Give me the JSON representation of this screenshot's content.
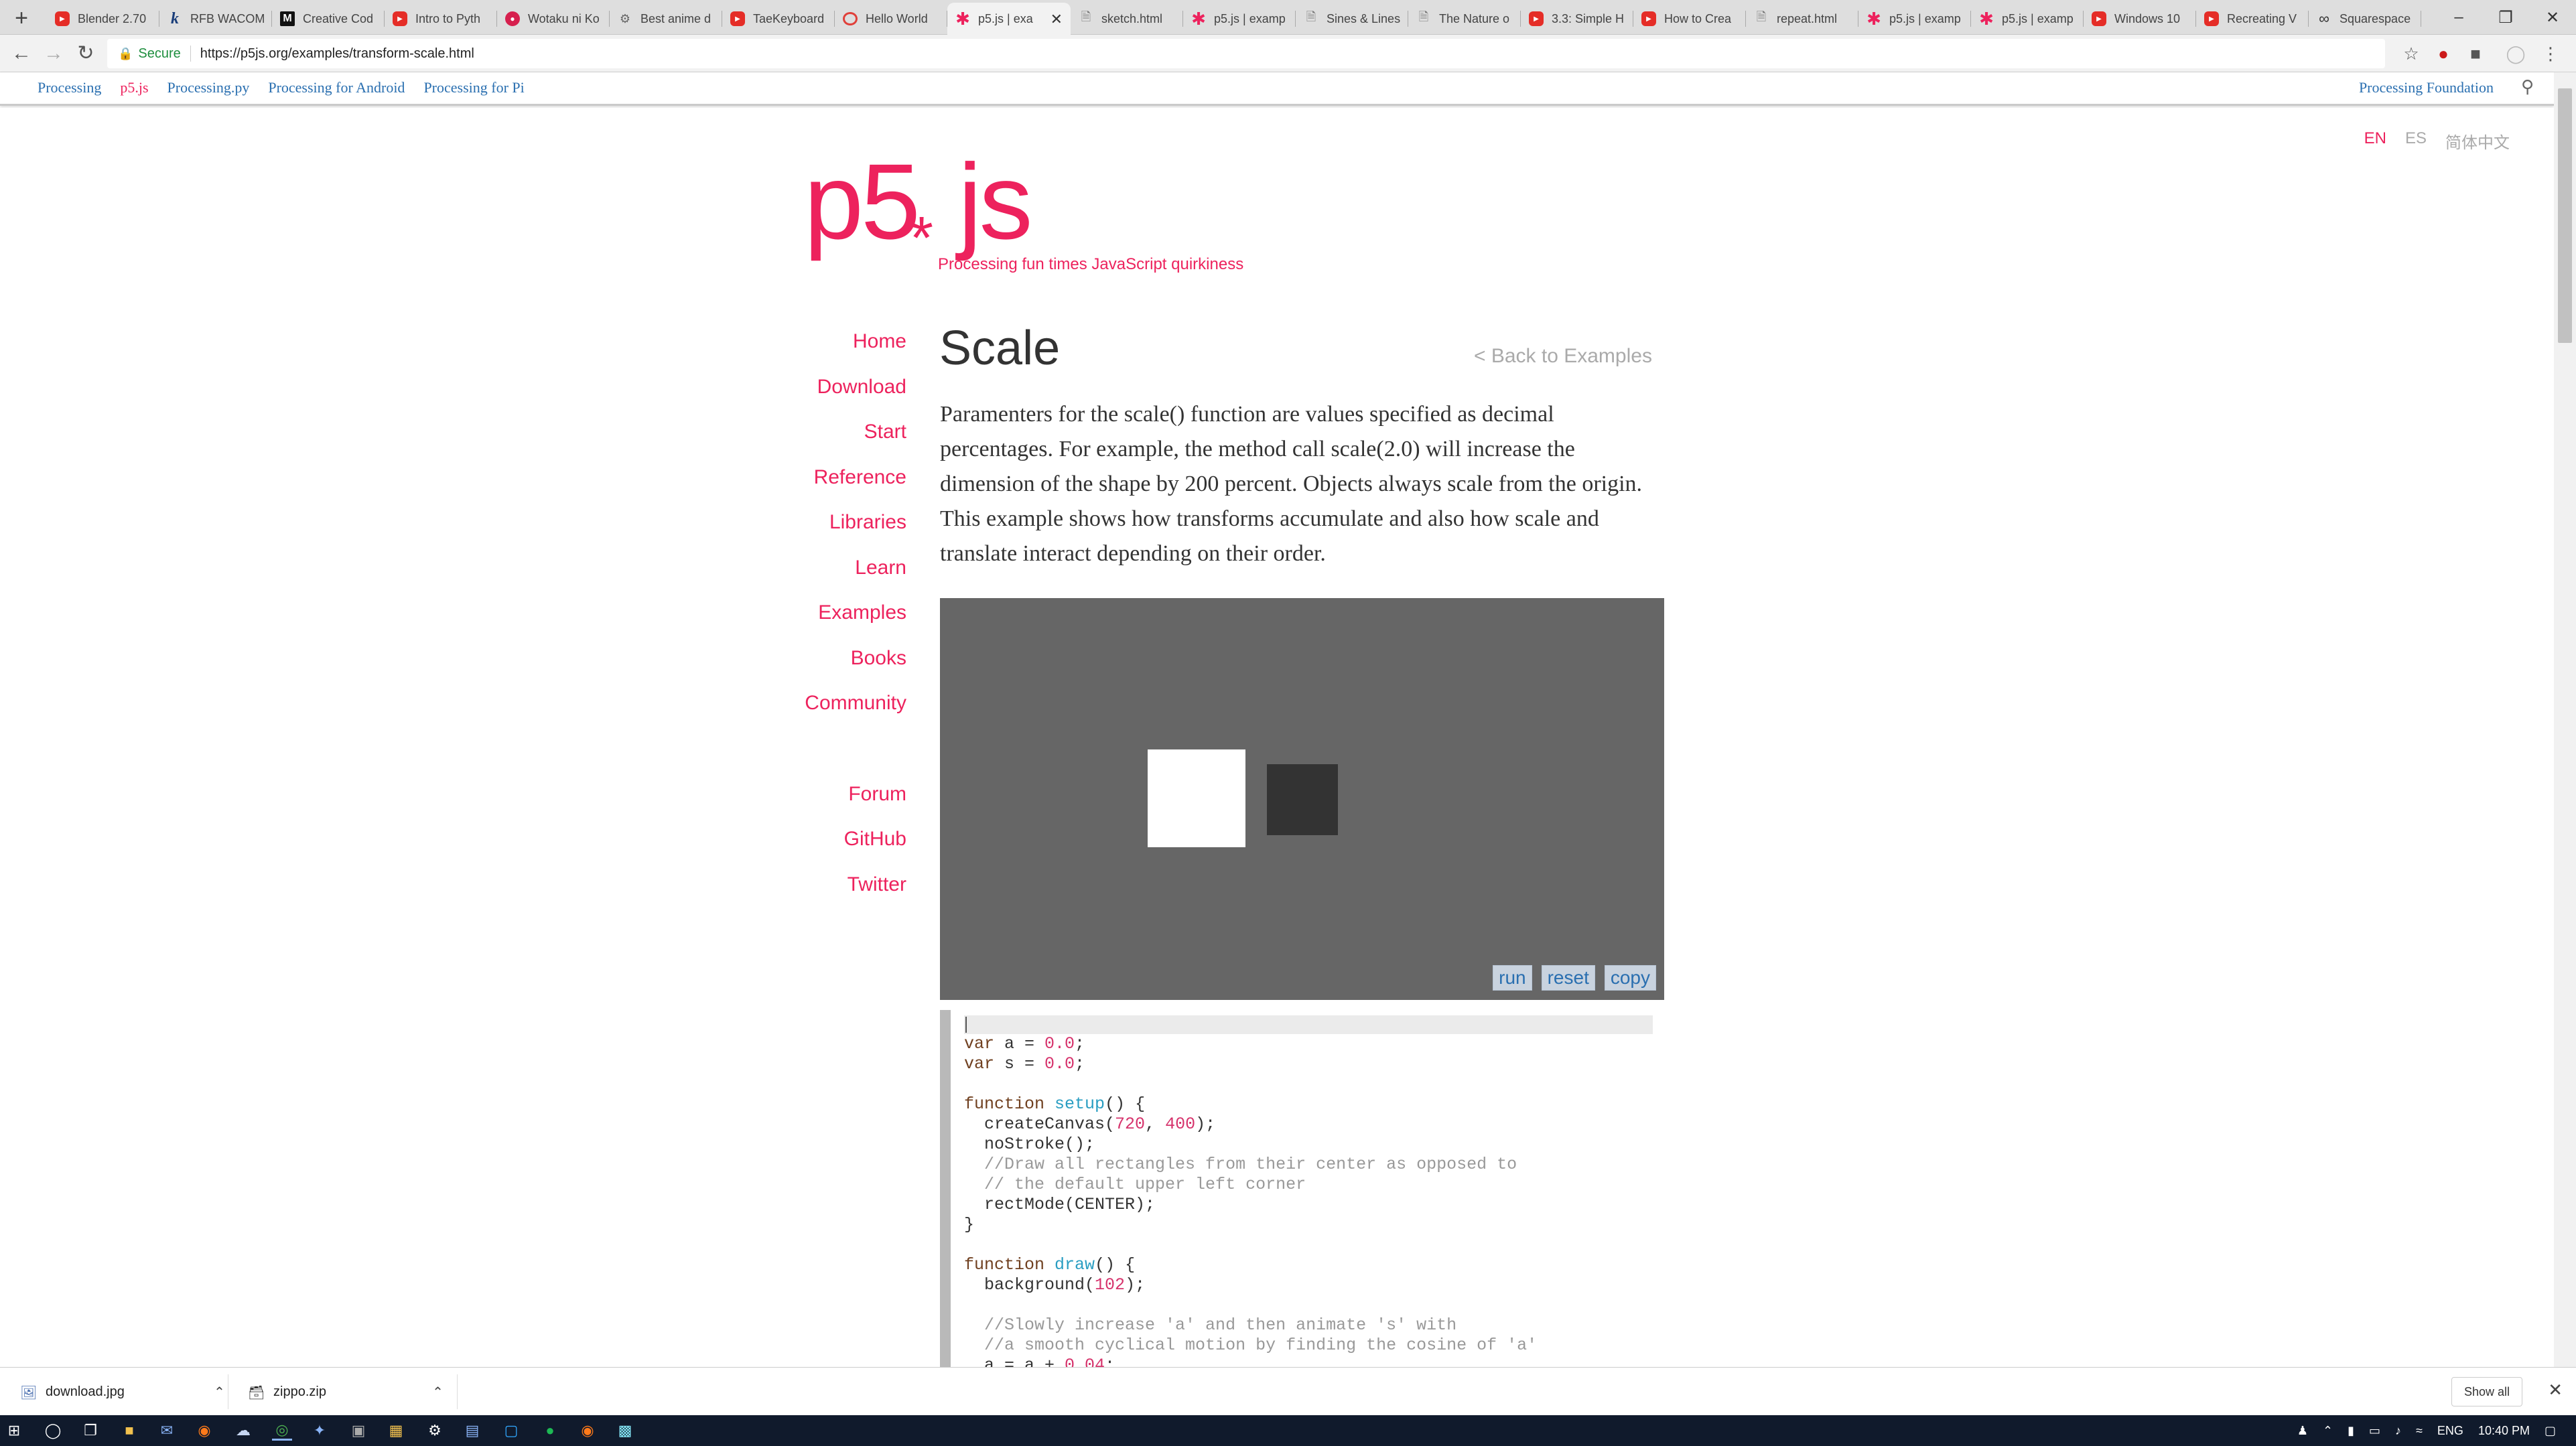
{
  "browser": {
    "tabs": [
      {
        "label": "Blender 2.70",
        "icon": "youtube-icon"
      },
      {
        "label": "RFB WACOM",
        "icon": "k-icon"
      },
      {
        "label": "Creative Cod",
        "icon": "medium-icon"
      },
      {
        "label": "Intro to Pyth",
        "icon": "youtube-icon"
      },
      {
        "label": "Wotaku ni Ko",
        "icon": "wo-icon"
      },
      {
        "label": "Best anime d",
        "icon": "download-icon"
      },
      {
        "label": "TaeKeyboard",
        "icon": "youtube-icon"
      },
      {
        "label": "Hello World",
        "icon": "hello-icon"
      },
      {
        "label": "p5.js | exa",
        "icon": "p5-icon",
        "active": true
      },
      {
        "label": "sketch.html",
        "icon": "document-icon"
      },
      {
        "label": "p5.js | examp",
        "icon": "p5-icon"
      },
      {
        "label": "Sines & Lines",
        "icon": "document-icon"
      },
      {
        "label": "The Nature o",
        "icon": "document-icon"
      },
      {
        "label": "3.3: Simple H",
        "icon": "youtube-icon"
      },
      {
        "label": "How to Crea",
        "icon": "youtube-icon"
      },
      {
        "label": "repeat.html",
        "icon": "document-icon"
      },
      {
        "label": "p5.js | examp",
        "icon": "p5-icon"
      },
      {
        "label": "p5.js | examp",
        "icon": "p5-icon"
      },
      {
        "label": "Windows 10",
        "icon": "youtube-icon"
      },
      {
        "label": "Recreating V",
        "icon": "youtube-icon"
      },
      {
        "label": "Squarespace",
        "icon": "squarespace-icon"
      }
    ],
    "secure_label": "Secure",
    "url": "https://p5js.org/examples/transform-scale.html"
  },
  "processing_bar": {
    "links": [
      "Processing",
      "p5.js",
      "Processing.py",
      "Processing for Android",
      "Processing for Pi"
    ],
    "current": "p5.js",
    "foundation": "Processing Foundation"
  },
  "languages": [
    "EN",
    "ES",
    "简体中文"
  ],
  "site": {
    "logo_p5": "p5",
    "logo_star": "*",
    "logo_js": "js",
    "tagline": "Processing fun times JavaScript quirkiness"
  },
  "nav": {
    "main": [
      "Home",
      "Download",
      "Start",
      "Reference",
      "Libraries",
      "Learn",
      "Examples",
      "Books",
      "Community"
    ],
    "social": [
      "Forum",
      "GitHub",
      "Twitter"
    ]
  },
  "example": {
    "title": "Scale",
    "back_link": "< Back to Examples",
    "description": "Paramenters for the scale() function are values specified as decimal percentages. For example, the method call scale(2.0) will increase the dimension of the shape by 200 percent. Objects always scale from the origin. This example shows how transforms accumulate and also how scale and translate interact depending on their order.",
    "buttons": {
      "run": "run",
      "reset": "reset",
      "copy": "copy"
    },
    "code": [
      [
        [
          "kw",
          "var"
        ],
        [
          "t",
          " a = "
        ],
        [
          "num",
          "0.0"
        ],
        [
          "t",
          ";"
        ]
      ],
      [
        [
          "kw",
          "var"
        ],
        [
          "t",
          " s = "
        ],
        [
          "num",
          "0.0"
        ],
        [
          "t",
          ";"
        ]
      ],
      [],
      [
        [
          "kw",
          "function"
        ],
        [
          "t",
          " "
        ],
        [
          "fn",
          "setup"
        ],
        [
          "t",
          "() {"
        ]
      ],
      [
        [
          "t",
          "  createCanvas("
        ],
        [
          "num",
          "720"
        ],
        [
          "t",
          ", "
        ],
        [
          "num",
          "400"
        ],
        [
          "t",
          ");"
        ]
      ],
      [
        [
          "t",
          "  noStroke();"
        ]
      ],
      [
        [
          "cm",
          "  //Draw all rectangles from their center as opposed to"
        ]
      ],
      [
        [
          "cm",
          "  // the default upper left corner"
        ]
      ],
      [
        [
          "t",
          "  rectMode(CENTER);"
        ]
      ],
      [
        [
          "t",
          "}"
        ]
      ],
      [],
      [
        [
          "kw",
          "function"
        ],
        [
          "t",
          " "
        ],
        [
          "fn",
          "draw"
        ],
        [
          "t",
          "() {"
        ]
      ],
      [
        [
          "t",
          "  background("
        ],
        [
          "num",
          "102"
        ],
        [
          "t",
          ");"
        ]
      ],
      [],
      [
        [
          "cm",
          "  //Slowly increase 'a' and then animate 's' with"
        ]
      ],
      [
        [
          "cm",
          "  //a smooth cyclical motion by finding the cosine of 'a'"
        ]
      ],
      [
        [
          "t",
          "  a = a + "
        ],
        [
          "num",
          "0.04"
        ],
        [
          "t",
          ";"
        ]
      ]
    ]
  },
  "downloads": [
    {
      "name": "download.jpg"
    },
    {
      "name": "zippo.zip"
    }
  ],
  "downloads_show_all": "Show all",
  "taskbar": {
    "language": "ENG",
    "time": "10:40 PM"
  },
  "colors": {
    "accent": "#ed225d",
    "link": "#2a6fb0",
    "canvas_bg": "#666666"
  }
}
